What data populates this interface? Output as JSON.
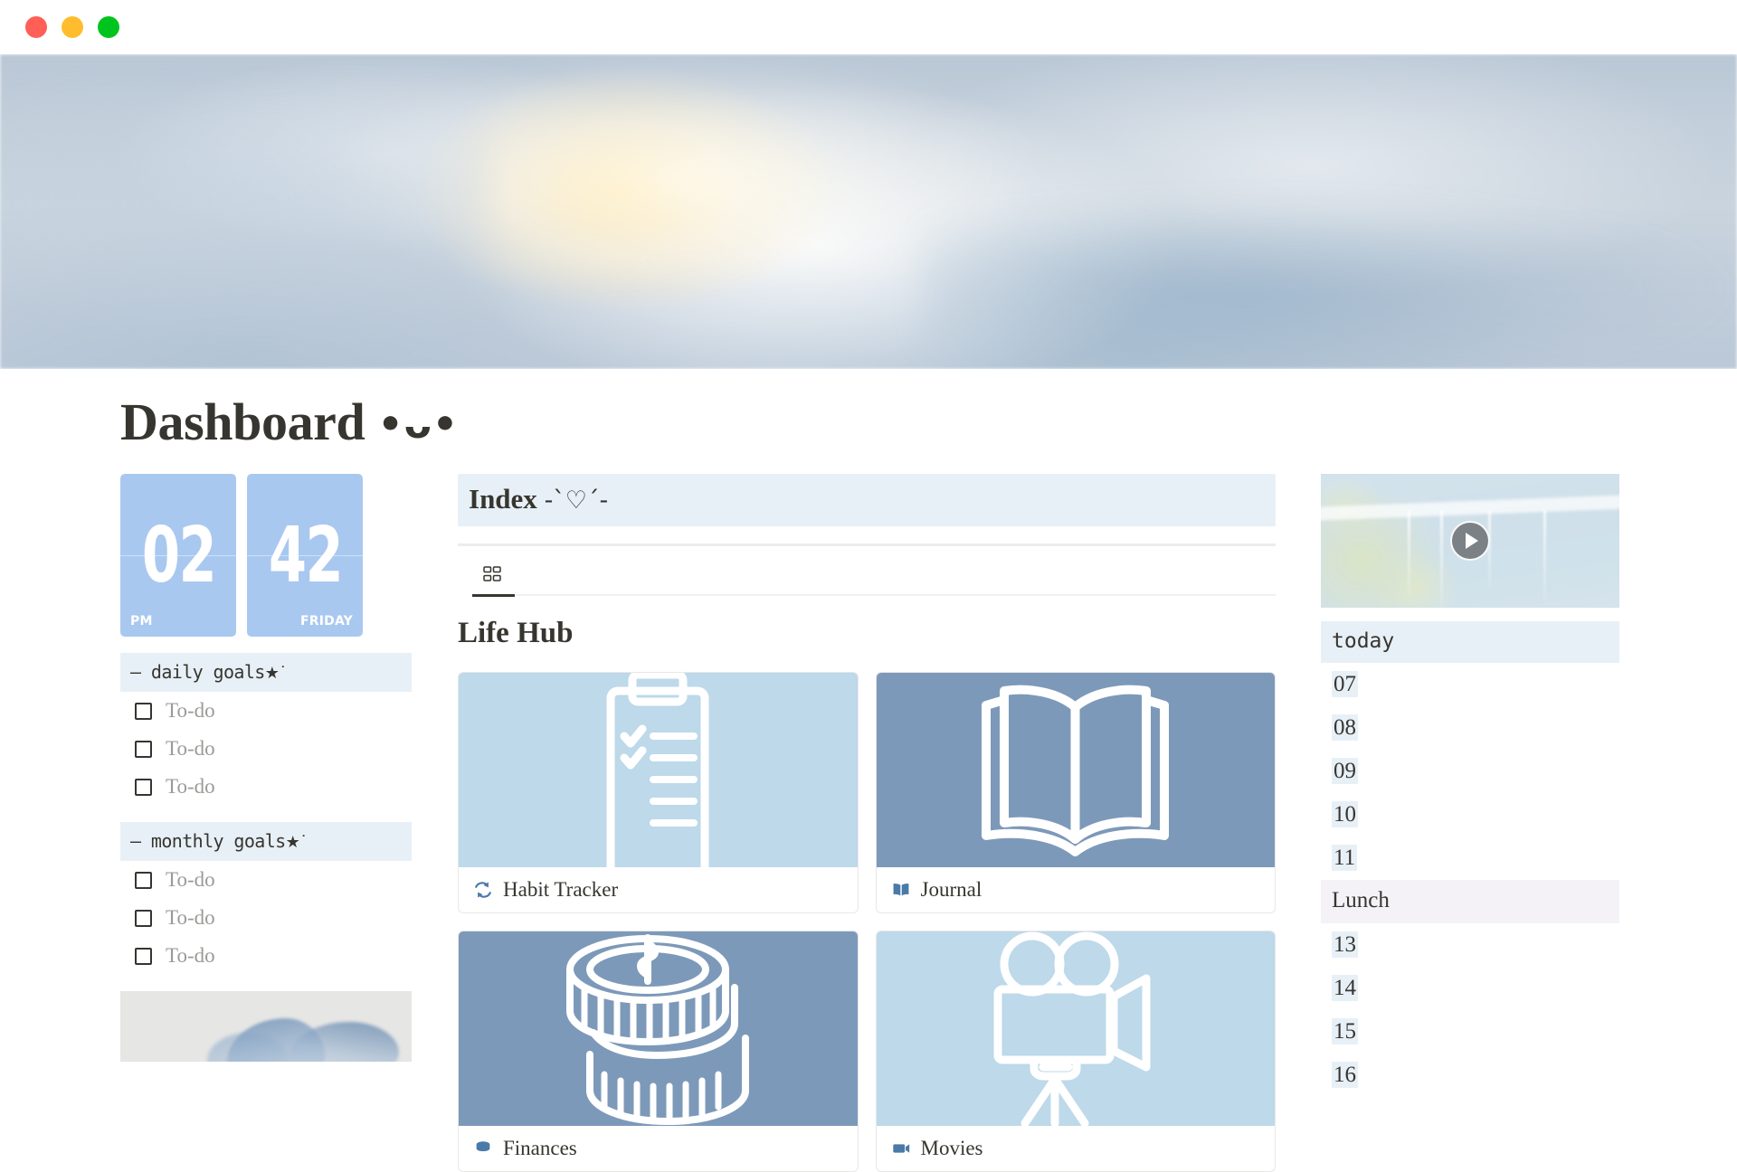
{
  "window": {
    "traffic_lights": [
      {
        "name": "close",
        "color": "#FF5F57"
      },
      {
        "name": "minimize",
        "color": "#FFBD2E"
      },
      {
        "name": "maximize",
        "color": "#00C41E"
      }
    ]
  },
  "page": {
    "title": "Dashboard",
    "title_kaomoji": "•ᴗ•"
  },
  "clock": {
    "hours": "02",
    "minutes": "42",
    "meridiem": "PM",
    "weekday": "FRIDAY"
  },
  "goals": {
    "daily": {
      "header": "— daily goals",
      "header_star": "★˙",
      "items": [
        {
          "label": "To-do",
          "checked": false
        },
        {
          "label": "To-do",
          "checked": false
        },
        {
          "label": "To-do",
          "checked": false
        }
      ]
    },
    "monthly": {
      "header": "— monthly goals",
      "header_star": "★˙",
      "items": [
        {
          "label": "To-do",
          "checked": false
        },
        {
          "label": "To-do",
          "checked": false
        },
        {
          "label": "To-do",
          "checked": false
        }
      ]
    }
  },
  "index": {
    "header": "Index",
    "header_deco": "-`♡´-",
    "tabs": [
      {
        "name": "gallery",
        "icon": "grid-icon",
        "active": true
      }
    ],
    "section_title": "Life Hub",
    "cards": [
      {
        "label": "Habit Tracker",
        "icon": "refresh-icon",
        "art": "clipboard",
        "bg": "#bdd9ea"
      },
      {
        "label": "Journal",
        "icon": "open-book-icon",
        "art": "book",
        "bg": "#7d99b9"
      },
      {
        "label": "Finances",
        "icon": "coins-icon",
        "art": "coins",
        "bg": "#7d99b9"
      },
      {
        "label": "Movies",
        "icon": "camera-icon",
        "art": "camera",
        "bg": "#bdd9ea"
      }
    ]
  },
  "schedule": {
    "video": {
      "name": "rain-video",
      "play_label": "Play"
    },
    "header": "today",
    "rows": [
      {
        "label": "07",
        "type": "hour"
      },
      {
        "label": "08",
        "type": "hour"
      },
      {
        "label": "09",
        "type": "hour"
      },
      {
        "label": "10",
        "type": "hour"
      },
      {
        "label": "11",
        "type": "hour"
      },
      {
        "label": "Lunch",
        "type": "break"
      },
      {
        "label": "13",
        "type": "hour"
      },
      {
        "label": "14",
        "type": "hour"
      },
      {
        "label": "15",
        "type": "hour"
      },
      {
        "label": "16",
        "type": "hour"
      }
    ]
  },
  "colors": {
    "accent_blue": "#a9c8f0",
    "highlight": "#e8f0f7",
    "break_highlight": "#f5f2f7",
    "card_light": "#bdd9ea",
    "card_dark": "#7d99b9",
    "text": "#37352f",
    "muted": "#9b9a97"
  }
}
